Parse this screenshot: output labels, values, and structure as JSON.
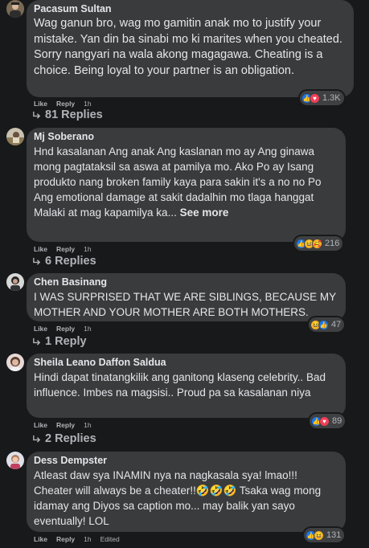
{
  "actions": {
    "like": "Like",
    "reply": "Reply",
    "edited": "Edited"
  },
  "comments": [
    {
      "author": "Pacasum Sultan",
      "text": "Wag ganun bro, wag mo gamitin anak mo to justify your mistake. Yan din ba sinabi mo ki marites when you cheated. Sorry nangyari na wala akong magagawa. Cheating is a choice. Being loyal to your partner is an obligation.",
      "time": "1h",
      "reaction_icons": [
        "like-icon",
        "love-icon"
      ],
      "reaction_count": "1.3K",
      "replies": "81 Replies"
    },
    {
      "author": "Mj Soberano",
      "text": "Hnd kasalanan Ang anak Ang kaslanan mo ay Ang ginawa mong pagtataksil sa aswa at pamilya mo. Ako Po ay Isang produkto nang broken family kaya para sakin it's a no no Po Ang emotional damage at sakit dadalhin mo tlaga hanggat Malaki at mag kapamilya ka...",
      "see_more": "See more",
      "time": "1h",
      "reaction_icons": [
        "like-icon",
        "haha-icon",
        "care-icon"
      ],
      "reaction_count": "216",
      "replies": "6 Replies"
    },
    {
      "author": "Chen Basinang",
      "text": "I WAS SURPRISED THAT WE ARE SIBLINGS, BECAUSE MY MOTHER AND YOUR MOTHER ARE BOTH MOTHERS.",
      "time": "1h",
      "reaction_icons": [
        "haha-icon",
        "like-icon"
      ],
      "reaction_count": "47",
      "replies": "1 Reply"
    },
    {
      "author": "Sheila Leano Daffon Saldua",
      "text": "Hindi dapat tinatangkilik ang ganitong klaseng celebrity.. Bad influence. Imbes na magsisi.. Proud pa sa kasalanan niya",
      "time": "1h",
      "reaction_icons": [
        "like-icon",
        "love-icon"
      ],
      "reaction_count": "89",
      "replies": "2 Replies"
    },
    {
      "author": "Dess Dempster",
      "text": "Atleast daw sya INAMIN nya na nagkasala sya! lmao!!! Cheater will always be a cheater!!🤣🤣🤣 Tsaka wag mong idamay ang Diyos sa caption mo... may balik yan sayo eventually! LOL",
      "time": "1h",
      "reaction_icons": [
        "like-icon",
        "haha-icon"
      ],
      "reaction_count": "131"
    }
  ]
}
